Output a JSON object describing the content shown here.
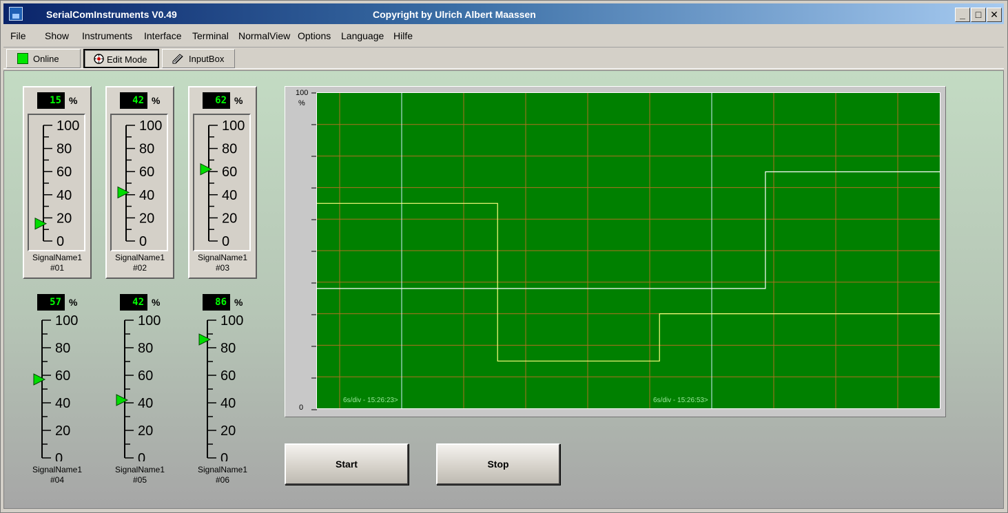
{
  "window": {
    "title": "SerialComInstruments  V0.49",
    "copyright": "Copyright by Ulrich Albert Maassen",
    "minimize": "_",
    "maximize": "□",
    "close": "✕"
  },
  "menu": [
    "File",
    "Show",
    "Instruments",
    "Interface",
    "Terminal",
    "NormalView",
    "Options",
    "Language",
    "Hilfe"
  ],
  "toolbar": {
    "online": "Online",
    "edit_mode": "Edit Mode",
    "input_box": "InputBox"
  },
  "instruments": [
    {
      "value": "15",
      "unit": "%",
      "name": "SignalName1",
      "id": "#01",
      "level": 15
    },
    {
      "value": "42",
      "unit": "%",
      "name": "SignalName1",
      "id": "#02",
      "level": 42
    },
    {
      "value": "62",
      "unit": "%",
      "name": "SignalName1",
      "id": "#03",
      "level": 62
    },
    {
      "value": "57",
      "unit": "%",
      "name": "SignalName1",
      "id": "#04",
      "level": 57
    },
    {
      "value": "42",
      "unit": "%",
      "name": "SignalName1",
      "id": "#05",
      "level": 42
    },
    {
      "value": "86",
      "unit": "%",
      "name": "SignalName1",
      "id": "#06",
      "level": 86
    }
  ],
  "scale_ticks": [
    "100",
    "80",
    "60",
    "40",
    "20",
    "0"
  ],
  "chart": {
    "y_max": "100",
    "y_min": "0",
    "unit": "%",
    "time_label_1": "6s/div - 15:26:23>",
    "time_label_2": "6s/div - 15:26:53>"
  },
  "buttons": {
    "start": "Start",
    "stop": "Stop"
  },
  "colors": {
    "plot_bg": "#008000",
    "grid": "#b07020",
    "trace_yellow": "#ffff80",
    "trace_white": "#ffffff",
    "led_green": "#00e600"
  },
  "chart_data": {
    "type": "line",
    "ylim": [
      0,
      100
    ],
    "series": [
      {
        "x": [
          0,
          2.9,
          2.9,
          5.5,
          5.5,
          10
        ],
        "values": [
          65,
          65,
          15,
          15,
          30,
          30
        ]
      },
      {
        "x": [
          0,
          7.2,
          7.2,
          10
        ],
        "values": [
          38,
          38,
          75,
          75
        ]
      }
    ]
  }
}
